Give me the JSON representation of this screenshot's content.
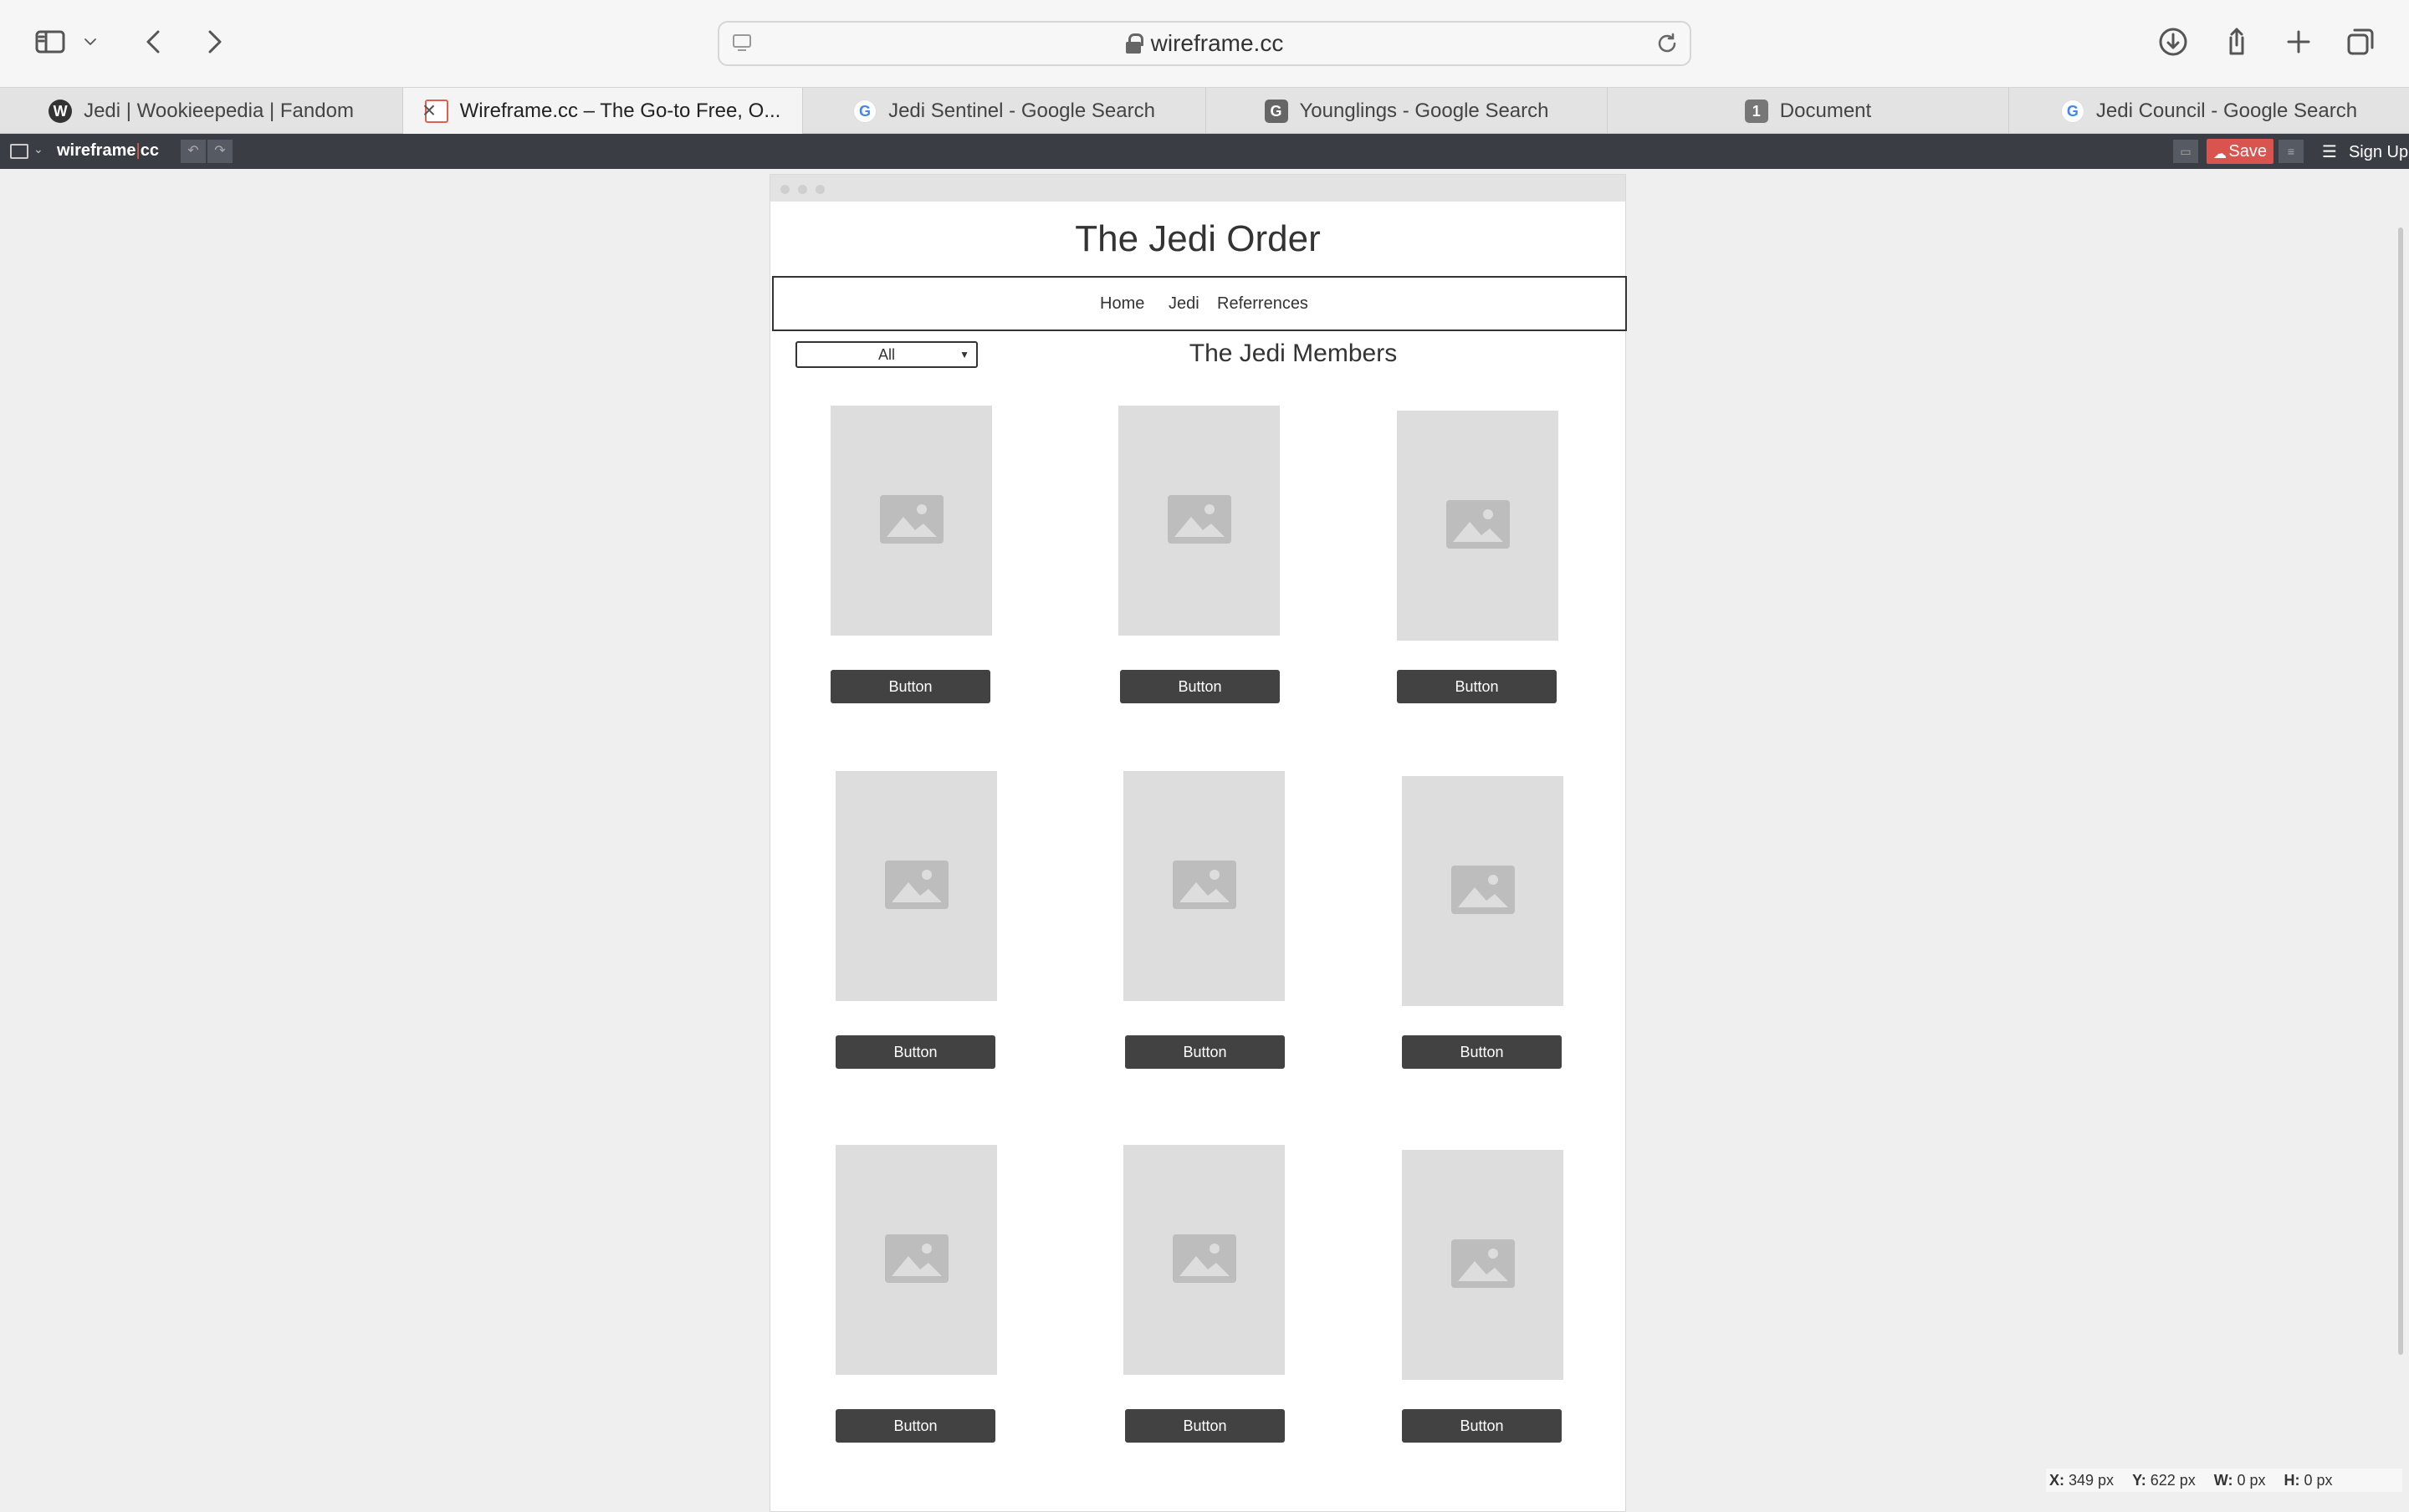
{
  "browser": {
    "address": "wireframe.cc",
    "tabs": [
      {
        "label": "Jedi | Wookieepedia | Fandom",
        "icon": "wookieepedia-icon"
      },
      {
        "label": "Wireframe.cc – The Go-to Free, O...",
        "icon": "wireframe-icon",
        "active": true
      },
      {
        "label": "Jedi Sentinel - Google Search",
        "icon": "google-icon"
      },
      {
        "label": "Younglings - Google Search",
        "icon": "g-icon"
      },
      {
        "label": "Document",
        "icon": "number-1-icon",
        "badge": "1"
      },
      {
        "label": "Jedi Council - Google Search",
        "icon": "google-icon"
      }
    ]
  },
  "app": {
    "logo_left": "wireframe",
    "logo_sep": "|",
    "logo_right": "cc",
    "save_label": "Save",
    "signup_label": "Sign Up"
  },
  "wireframe": {
    "title": "The Jedi Order",
    "nav": [
      "Home",
      "Jedi",
      "Referrences"
    ],
    "filter_value": "All",
    "section_title": "The Jedi Members",
    "button_label": "Button"
  },
  "status": {
    "x": "349 px",
    "y": "622 px",
    "w": "0 px",
    "h": "0 px"
  },
  "colors": {
    "save": "#d9534f",
    "appbar": "#3a3d44",
    "button": "#424242",
    "placeholder": "#dddddd"
  }
}
